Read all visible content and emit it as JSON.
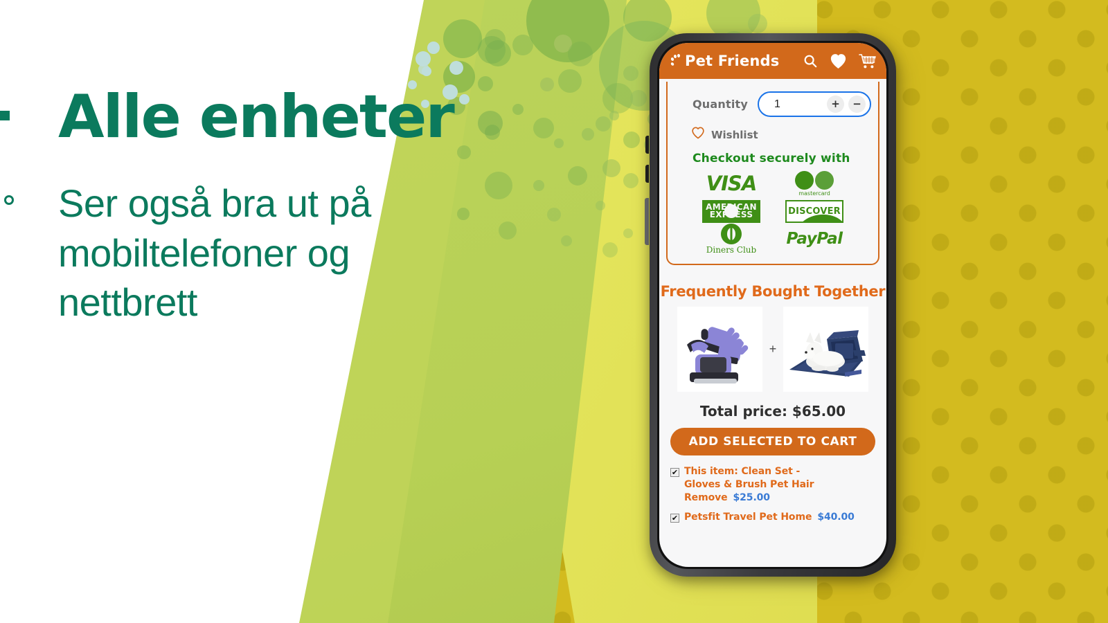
{
  "promo": {
    "headline": "Alle enheter",
    "subheadline": "Ser også bra ut på mobiltelefoner og nettbrett",
    "brand_green": "#0b7a5d",
    "background_mustard": "#d3bb1f",
    "background_green": "#bcd45c",
    "background_yellow": "#e6e75f"
  },
  "app": {
    "header": {
      "brand_name": "Pet Friends",
      "brand_bg": "#d2691b",
      "icons": [
        {
          "name": "search-icon",
          "label": "Search"
        },
        {
          "name": "heart-icon",
          "label": "Wishlist"
        },
        {
          "name": "cart-icon",
          "label": "Cart"
        }
      ]
    },
    "quantity": {
      "label": "Quantity",
      "value": "1",
      "increment_label": "+",
      "decrement_label": "−",
      "focus_color": "#1a73e8"
    },
    "wishlist": {
      "label": "Wishlist"
    },
    "checkout": {
      "title": "Checkout securely with",
      "title_color": "#1e8a1e",
      "methods": [
        {
          "name": "visa",
          "label": "VISA"
        },
        {
          "name": "mastercard",
          "label": "mastercard"
        },
        {
          "name": "american-express",
          "label": "AMERICAN EXPRESS"
        },
        {
          "name": "discover",
          "label": "DISCOVER"
        },
        {
          "name": "diners-club",
          "label": "Diners Club"
        },
        {
          "name": "paypal",
          "label": "PayPal"
        }
      ]
    },
    "frequently_bought_together": {
      "title": "Frequently Bought Together",
      "title_color": "#e06a1b",
      "plus_symbol": "+",
      "products": [
        {
          "name": "clean-set-gloves-brush",
          "alt": "Purple pet grooming gloves and brush"
        },
        {
          "name": "petsfit-travel-pet-home",
          "alt": "White dog in navy blue pet carrier"
        }
      ],
      "total_label": "Total price:",
      "total_price": "$65.00",
      "total_line": "Total price: $65.00",
      "add_button_label": "ADD SELECTED TO CART",
      "items": [
        {
          "checked": "✔",
          "label": "This item: Clean Set - Gloves & Brush Pet Hair Remove",
          "label_line1": "This item: Clean Set -",
          "label_line2": "Gloves & Brush Pet Hair Remove",
          "price": "$25.00"
        },
        {
          "checked": "✔",
          "label": "Petsfit Travel Pet Home",
          "label_line1": "Petsfit Travel Pet Home",
          "label_line2": "",
          "price": "$40.00"
        }
      ]
    }
  }
}
